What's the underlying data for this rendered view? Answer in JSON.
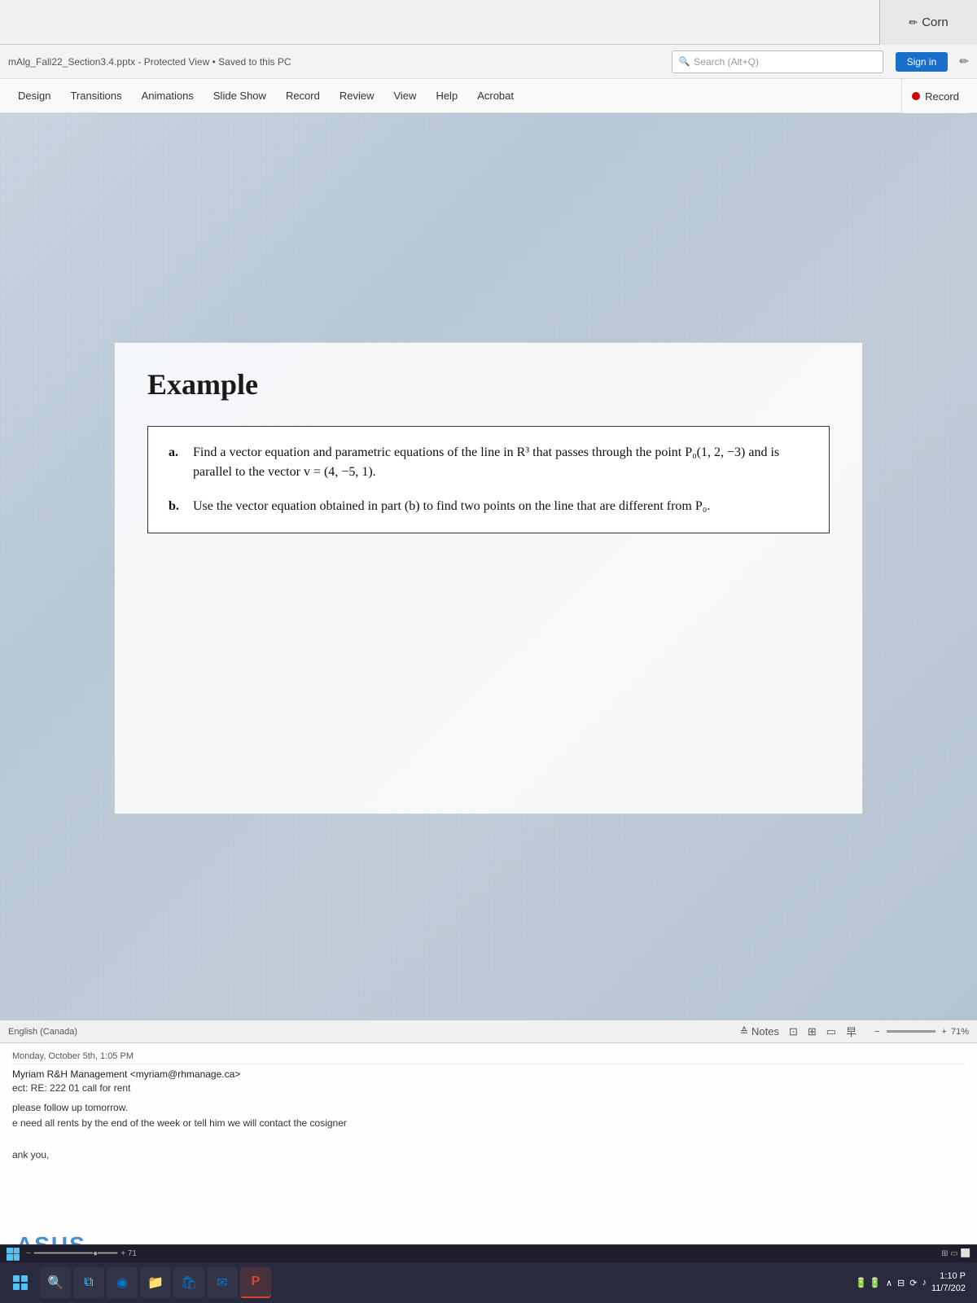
{
  "window": {
    "corner_label": "Corn",
    "corner_icon": "✏"
  },
  "titlebar": {
    "filename": "mAlg_Fall22_Section3.4.pptx",
    "separator1": " - ",
    "status": "Protected View • Saved to this PC",
    "search_placeholder": "Search (Alt+Q)",
    "sign_in_label": "Sign in",
    "edit_icon": "✏"
  },
  "ribbon": {
    "items": [
      {
        "id": "design",
        "label": "Design"
      },
      {
        "id": "transitions",
        "label": "Transitions"
      },
      {
        "id": "animations",
        "label": "Animations"
      },
      {
        "id": "slideshow",
        "label": "Slide Show"
      },
      {
        "id": "record",
        "label": "Record"
      },
      {
        "id": "review",
        "label": "Review"
      },
      {
        "id": "view",
        "label": "View"
      },
      {
        "id": "help",
        "label": "Help"
      },
      {
        "id": "acrobat",
        "label": "Acrobat"
      }
    ],
    "record_right_label": "Record"
  },
  "slide": {
    "title": "Example",
    "items": [
      {
        "label": "a.",
        "text": "Find a vector equation and parametric equations of the line in R³ that passes through the point P₀(1, 2, −3) and is parallel to the vector v = (4, −5, 1)."
      },
      {
        "label": "b.",
        "text": "Use the vector equation obtained in part (b) to find two points on the line that are different from P₀."
      }
    ]
  },
  "statusbar": {
    "language": "English (Canada)",
    "notes_label": "Notes",
    "view_icons": [
      "⊡",
      "⊞",
      "▭",
      "早"
    ],
    "zoom_value": "71"
  },
  "email": {
    "header_date": "Monday, October 5th, 1:05 PM",
    "from": "Myriam R&H Management <myriam@rhmanage.ca>",
    "subject": "ect: RE: 222 01 call for rent",
    "body_lines": [
      "please follow up tomorrow.",
      "e need all rents by the end of the week or tell him we will contact the cosigner",
      "",
      "ank you,"
    ]
  },
  "taskbar": {
    "system_icons": [
      "∧",
      "⊟",
      "⟳",
      "♪"
    ],
    "time": "1:10 P",
    "date": "11/7/202",
    "app_buttons": [
      {
        "id": "windows",
        "icon": "⊞",
        "color": "#4fc3f7"
      },
      {
        "id": "search",
        "icon": "⚲",
        "color": "#ffffff"
      },
      {
        "id": "taskview",
        "icon": "⧉",
        "color": "#4fc3f7"
      },
      {
        "id": "edge",
        "icon": "◉",
        "color": "#0078d4"
      },
      {
        "id": "folder",
        "icon": "📁",
        "color": "#ffb900"
      },
      {
        "id": "store",
        "icon": "🛍",
        "color": "#0078d4"
      },
      {
        "id": "mail",
        "icon": "✉",
        "color": "#0078d4"
      },
      {
        "id": "powerpoint",
        "icon": "P",
        "color": "#d24726"
      }
    ]
  },
  "asus_logo": "ASUS"
}
